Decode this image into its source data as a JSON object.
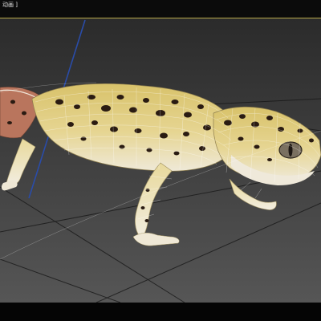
{
  "viewport": {
    "label": "动画 ]",
    "colors": {
      "background_top": "#2f2f2f",
      "background_bottom": "#555555",
      "grid": "#151515",
      "active_border": "#b9a84a",
      "axis_z": "#2a4ca8",
      "gecko_body": "#d9c67a",
      "gecko_belly": "#ece7d9",
      "gecko_spot": "#2a1b12",
      "wireframe": "#ffffff"
    }
  },
  "scene": {
    "object": "leopard-gecko-model",
    "icons": [
      "gecko-model-icon",
      "z-axis-icon",
      "wireframe-overlay-icon"
    ]
  }
}
